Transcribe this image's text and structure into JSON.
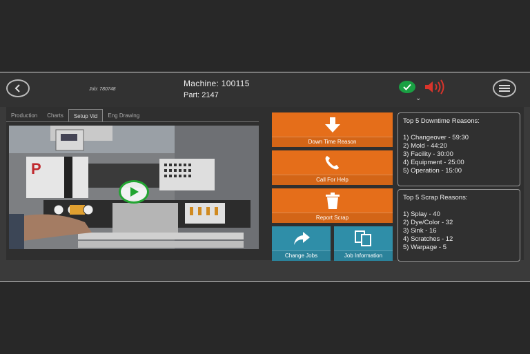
{
  "header": {
    "job_label": "Job: 780748",
    "machine": "Machine: 100115",
    "part": "Part: 2147"
  },
  "tabs": [
    "Production",
    "Charts",
    "Setup Vid",
    "Eng Drawing"
  ],
  "active_tab": "Setup Vid",
  "video": {
    "logo_text": "P"
  },
  "actions": {
    "down_time": "Down Time Reason",
    "call_help": "Call For Help",
    "report_scrap": "Report Scrap",
    "change_jobs": "Change Jobs",
    "job_information": "Job Information"
  },
  "downtime": {
    "title": "Top 5 Downtime Reasons:",
    "items": [
      "1) Changeover - 59:30",
      "2) Mold - 44:20",
      "3) Facility - 30:00",
      "4) Equipment - 25:00",
      "5) Operation - 15:00"
    ]
  },
  "scrap": {
    "title": "Top 5 Scrap Reasons:",
    "items": [
      "1) Splay - 40",
      "2) Dye/Color - 32",
      "3) Sink - 16",
      "4) Scratches - 12",
      "5) Warpage - 5"
    ]
  },
  "colors": {
    "orange": "#e56e1a",
    "teal": "#2f8ea8",
    "status_ok": "#1aa043",
    "alert": "#d9342b"
  }
}
